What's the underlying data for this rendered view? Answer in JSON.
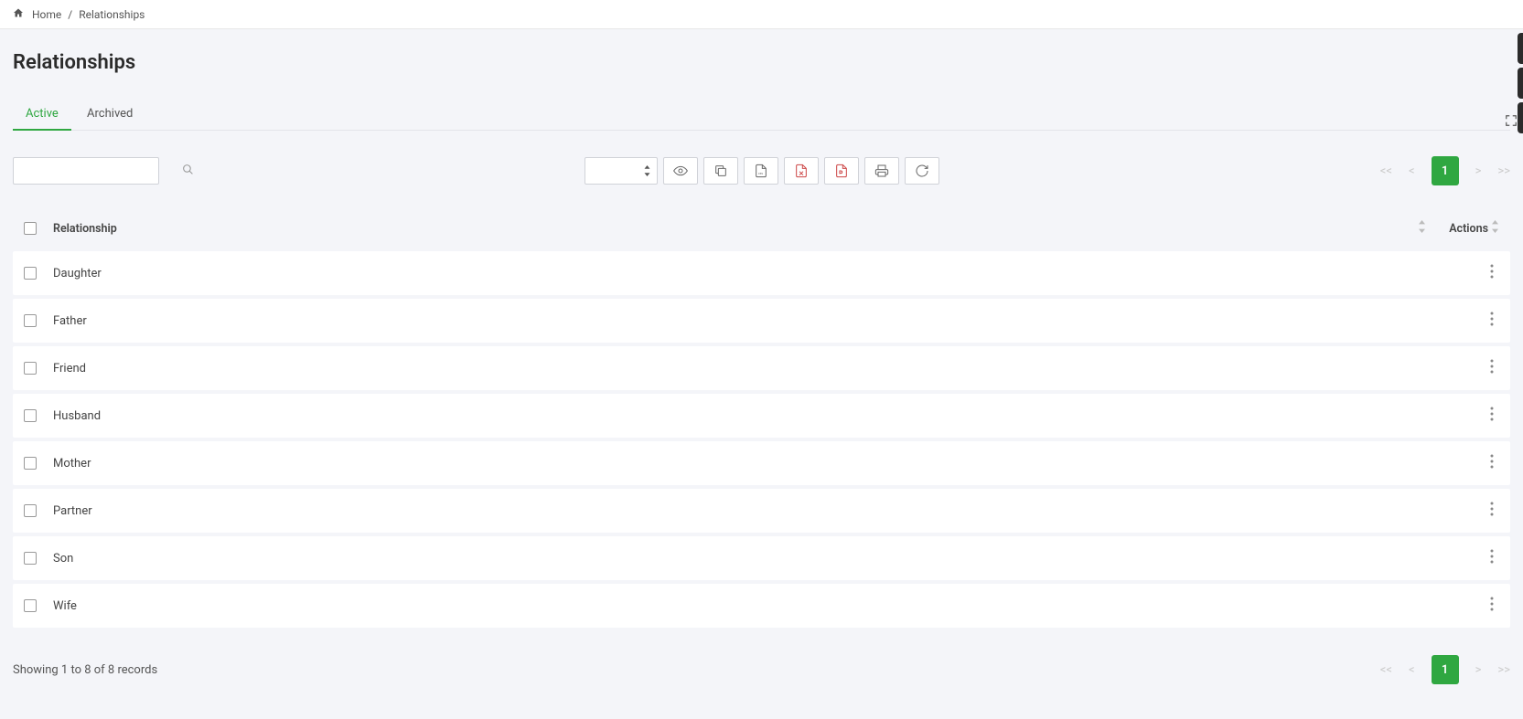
{
  "breadcrumb": {
    "home": "Home",
    "sep": "/",
    "current": "Relationships"
  },
  "page": {
    "title": "Relationships"
  },
  "tabs": {
    "active": "Active",
    "archived": "Archived"
  },
  "toolbar": {
    "search_value": "",
    "search_placeholder": ""
  },
  "pagination": {
    "first": "<<",
    "prev": "<",
    "current": "1",
    "next": ">",
    "last": ">>"
  },
  "table": {
    "header": {
      "relationship": "Relationship",
      "actions": "Actions"
    },
    "rows": [
      {
        "name": "Daughter"
      },
      {
        "name": "Father"
      },
      {
        "name": "Friend"
      },
      {
        "name": "Husband"
      },
      {
        "name": "Mother"
      },
      {
        "name": "Partner"
      },
      {
        "name": "Son"
      },
      {
        "name": "Wife"
      }
    ]
  },
  "footer": {
    "status": "Showing 1 to 8 of 8 records"
  },
  "icons": {
    "eye": "eye-icon",
    "copy": "copy-icon",
    "csv": "csv-icon",
    "xls": "xls-icon",
    "pdf": "pdf-icon",
    "print": "print-icon",
    "refresh": "refresh-icon"
  }
}
